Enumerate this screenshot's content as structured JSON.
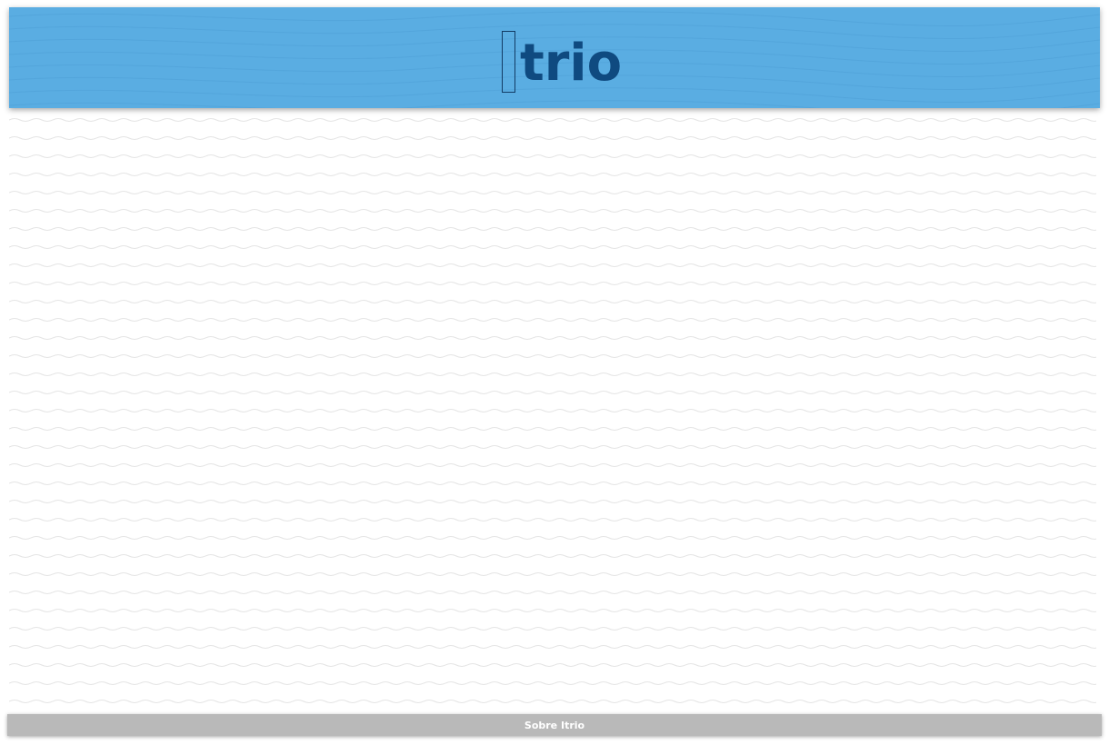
{
  "header": {
    "logo_text": "trio",
    "background_color": "#5aade2",
    "logo_color": "#0f4a80",
    "logo_icon": "rectangle-outline-icon"
  },
  "footer": {
    "link_label": "Sobre Itrio",
    "background_color": "#b9b9b9"
  }
}
